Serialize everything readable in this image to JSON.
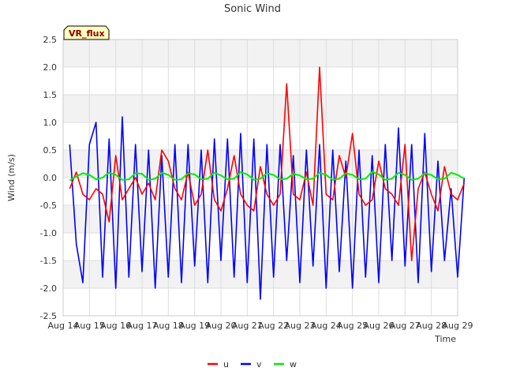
{
  "chart_data": {
    "type": "line",
    "title": "Sonic Wind",
    "xlabel": "Time",
    "ylabel": "Wind (m/s)",
    "tag": "VR_flux",
    "x_ticks": [
      "Aug 14",
      "Aug 15",
      "Aug 16",
      "Aug 17",
      "Aug 18",
      "Aug 19",
      "Aug 20",
      "Aug 21",
      "Aug 22",
      "Aug 23",
      "Aug 24",
      "Aug 25",
      "Aug 26",
      "Aug 27",
      "Aug 28",
      "Aug 29"
    ],
    "xlim": [
      0,
      15
    ],
    "ylim": [
      -2.5,
      2.5
    ],
    "y_ticks": [
      "-2.5",
      "-2.0",
      "-1.5",
      "-1.0",
      "-0.5",
      "0.0",
      "0.5",
      "1.0",
      "1.5",
      "2.0",
      "2.5"
    ],
    "grid": true,
    "legend_position": "bottom-center",
    "series": [
      {
        "name": "u",
        "color": "#ff0000",
        "x_start": 0.25,
        "x_step": 0.25,
        "values": [
          -0.2,
          0.1,
          -0.3,
          -0.4,
          -0.2,
          -0.3,
          -0.8,
          0.4,
          -0.4,
          -0.2,
          0.0,
          -0.3,
          -0.1,
          -0.4,
          0.5,
          0.3,
          -0.2,
          -0.4,
          0.1,
          -0.5,
          -0.3,
          0.5,
          -0.4,
          -0.6,
          -0.2,
          0.4,
          -0.3,
          -0.5,
          -0.6,
          0.2,
          -0.3,
          -0.5,
          -0.3,
          1.7,
          -0.3,
          -0.4,
          0.1,
          -0.5,
          2.0,
          -0.3,
          -0.4,
          0.4,
          0.0,
          0.8,
          -0.3,
          -0.5,
          -0.4,
          0.3,
          -0.2,
          -0.3,
          -0.5,
          0.6,
          -1.5,
          -0.2,
          0.1,
          -0.3,
          -0.6,
          0.2,
          -0.3,
          -0.4,
          -0.1
        ]
      },
      {
        "name": "v",
        "color": "#0000ff",
        "x_start": 0.25,
        "x_step": 0.25,
        "values": [
          0.6,
          -1.2,
          -1.9,
          0.6,
          1.0,
          -1.8,
          0.7,
          -2.0,
          1.1,
          -1.8,
          0.6,
          -1.7,
          0.5,
          -2.0,
          0.4,
          -1.8,
          0.6,
          -1.9,
          0.6,
          -1.6,
          0.5,
          -1.9,
          0.7,
          -1.5,
          0.7,
          -1.8,
          0.8,
          -1.9,
          0.7,
          -2.2,
          0.6,
          -1.8,
          0.6,
          -1.5,
          0.4,
          -1.9,
          0.5,
          -1.6,
          0.6,
          -2.0,
          0.5,
          -1.7,
          0.3,
          -2.0,
          0.5,
          -1.8,
          0.4,
          -1.9,
          0.6,
          -1.5,
          0.9,
          -1.6,
          0.6,
          -1.9,
          0.8,
          -1.7,
          0.3,
          -1.5,
          -0.2,
          -1.8,
          0.0
        ]
      },
      {
        "name": "w",
        "color": "#00ee00",
        "x_start": 0.25,
        "x_step": 0.25,
        "values": [
          -0.05,
          0.02,
          0.08,
          0.05,
          -0.03,
          0.0,
          0.09,
          0.05,
          -0.04,
          -0.03,
          0.08,
          0.07,
          -0.04,
          -0.02,
          0.09,
          0.05,
          -0.04,
          -0.03,
          0.08,
          0.06,
          -0.03,
          -0.02,
          0.09,
          0.04,
          -0.03,
          -0.02,
          0.1,
          0.06,
          -0.04,
          -0.02,
          0.08,
          0.05,
          -0.03,
          -0.02,
          0.07,
          0.04,
          -0.03,
          -0.02,
          0.09,
          0.05,
          -0.04,
          -0.02,
          0.08,
          0.05,
          -0.03,
          -0.02,
          0.11,
          0.06,
          -0.04,
          -0.02,
          0.09,
          0.05,
          -0.04,
          -0.02,
          0.08,
          0.05,
          -0.03,
          -0.02,
          0.09,
          0.05,
          -0.02
        ]
      }
    ]
  }
}
